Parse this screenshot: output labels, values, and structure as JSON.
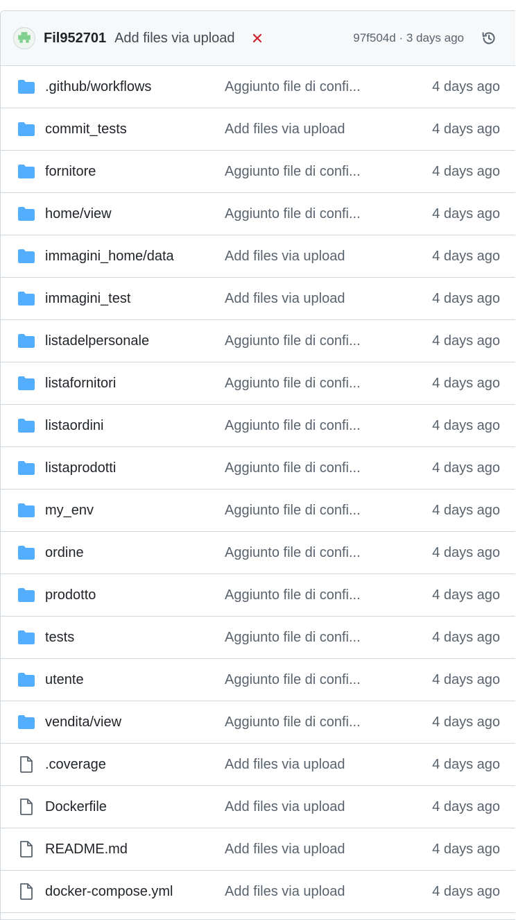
{
  "latest_commit": {
    "author": "Fil952701",
    "message": "Add files via upload",
    "status": "failed",
    "sha_and_time": "97f504d · 3 days ago",
    "avatar_icon": "identicon-avatar",
    "status_icon": "x-icon",
    "history_icon": "history-icon"
  },
  "colors": {
    "folder": "#54aeff",
    "file": "#59636e",
    "failure": "#cf222e",
    "header_bg": "#f6f8fa",
    "border": "#d0d7de"
  },
  "files": [
    {
      "type": "folder",
      "name": ".github/workflows",
      "message": "Aggiunto file di confi...",
      "age": "4 days ago"
    },
    {
      "type": "folder",
      "name": "commit_tests",
      "message": "Add files via upload",
      "age": "4 days ago"
    },
    {
      "type": "folder",
      "name": "fornitore",
      "message": "Aggiunto file di confi...",
      "age": "4 days ago"
    },
    {
      "type": "folder",
      "name": "home/view",
      "message": "Aggiunto file di confi...",
      "age": "4 days ago"
    },
    {
      "type": "folder",
      "name": "immagini_home/data",
      "message": "Add files via upload",
      "age": "4 days ago"
    },
    {
      "type": "folder",
      "name": "immagini_test",
      "message": "Add files via upload",
      "age": "4 days ago"
    },
    {
      "type": "folder",
      "name": "listadelpersonale",
      "message": "Aggiunto file di confi...",
      "age": "4 days ago"
    },
    {
      "type": "folder",
      "name": "listafornitori",
      "message": "Aggiunto file di confi...",
      "age": "4 days ago"
    },
    {
      "type": "folder",
      "name": "listaordini",
      "message": "Aggiunto file di confi...",
      "age": "4 days ago"
    },
    {
      "type": "folder",
      "name": "listaprodotti",
      "message": "Aggiunto file di confi...",
      "age": "4 days ago"
    },
    {
      "type": "folder",
      "name": "my_env",
      "message": "Aggiunto file di confi...",
      "age": "4 days ago"
    },
    {
      "type": "folder",
      "name": "ordine",
      "message": "Aggiunto file di confi...",
      "age": "4 days ago"
    },
    {
      "type": "folder",
      "name": "prodotto",
      "message": "Aggiunto file di confi...",
      "age": "4 days ago"
    },
    {
      "type": "folder",
      "name": "tests",
      "message": "Aggiunto file di confi...",
      "age": "4 days ago"
    },
    {
      "type": "folder",
      "name": "utente",
      "message": "Aggiunto file di confi...",
      "age": "4 days ago"
    },
    {
      "type": "folder",
      "name": "vendita/view",
      "message": "Aggiunto file di confi...",
      "age": "4 days ago"
    },
    {
      "type": "file",
      "name": ".coverage",
      "message": "Add files via upload",
      "age": "4 days ago"
    },
    {
      "type": "file",
      "name": "Dockerfile",
      "message": "Add files via upload",
      "age": "4 days ago"
    },
    {
      "type": "file",
      "name": "README.md",
      "message": "Add files via upload",
      "age": "4 days ago"
    },
    {
      "type": "file",
      "name": "docker-compose.yml",
      "message": "Add files via upload",
      "age": "4 days ago"
    }
  ]
}
